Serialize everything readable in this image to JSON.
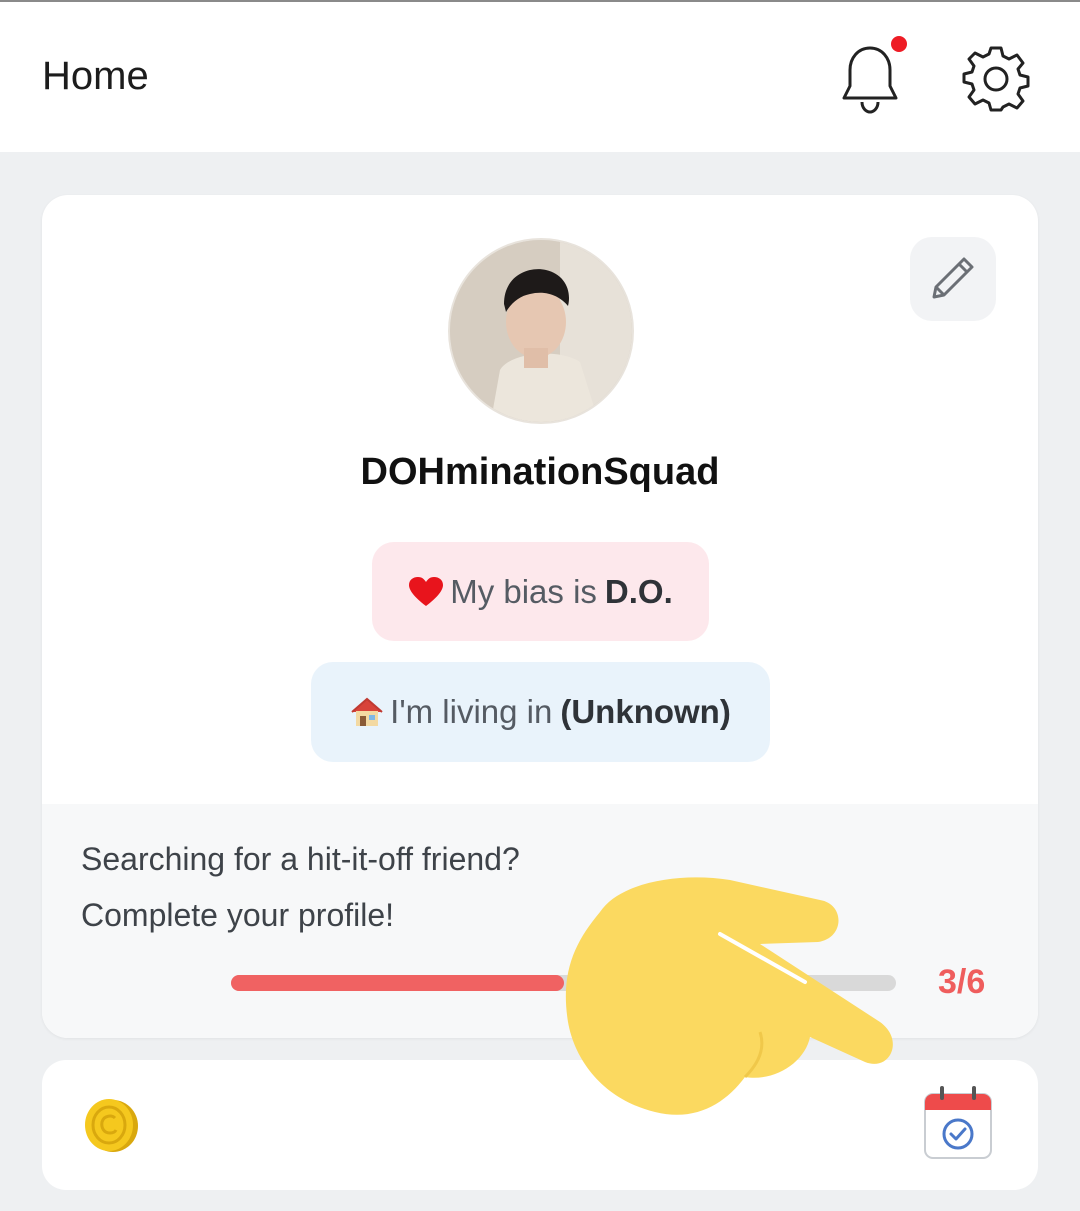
{
  "header": {
    "title": "Home",
    "notification_badge_color": "#ee1c25",
    "icons": [
      "bell-icon",
      "gear-icon"
    ]
  },
  "profile": {
    "username": "DOHminationSquad",
    "avatar": "avatar-photo",
    "edit_icon": "pencil-icon",
    "bias": {
      "emoji": "heart-icon",
      "prefix": "My bias is",
      "value": "D.O."
    },
    "location": {
      "emoji": "house-icon",
      "prefix": "I'm living in",
      "value": "(Unknown)"
    }
  },
  "completion": {
    "line1": "Searching for a hit-it-off friend?",
    "line2": "Complete your profile!",
    "count_text": "3/6",
    "progress_fraction": 0.5,
    "fill_color": "#f06262"
  },
  "footer": {
    "coin_icon": "coin-icon",
    "calendar_icon": "calendar-check-icon"
  },
  "colors": {
    "accent": "#ef5d5d",
    "background": "#eef0f2",
    "hand_overlay": "#fbd960"
  }
}
